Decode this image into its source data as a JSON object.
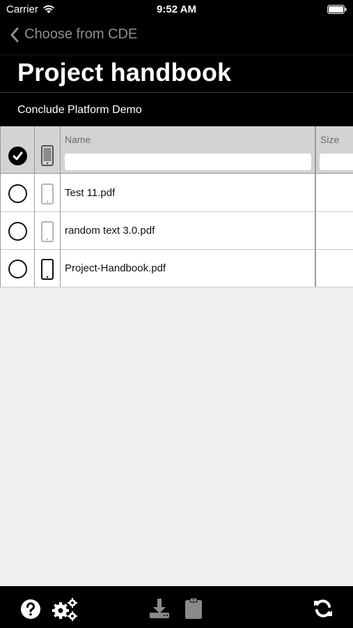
{
  "status_bar": {
    "carrier": "Carrier",
    "time": "9:52 AM"
  },
  "nav": {
    "back_label": "Choose from CDE"
  },
  "page": {
    "title": "Project handbook",
    "subtitle": "Conclude Platform Demo"
  },
  "table": {
    "columns": {
      "name": "Name",
      "size": "Size"
    },
    "rows": [
      {
        "name": "Test 11.pdf",
        "size": "",
        "downloaded": false
      },
      {
        "name": "random text 3.0.pdf",
        "size": "",
        "downloaded": false
      },
      {
        "name": "Project-Handbook.pdf",
        "size": "",
        "downloaded": true
      }
    ]
  },
  "toolbar": {
    "icons": [
      "help-icon",
      "settings-icon",
      "download-icon",
      "clipboard-icon",
      "refresh-icon"
    ]
  }
}
